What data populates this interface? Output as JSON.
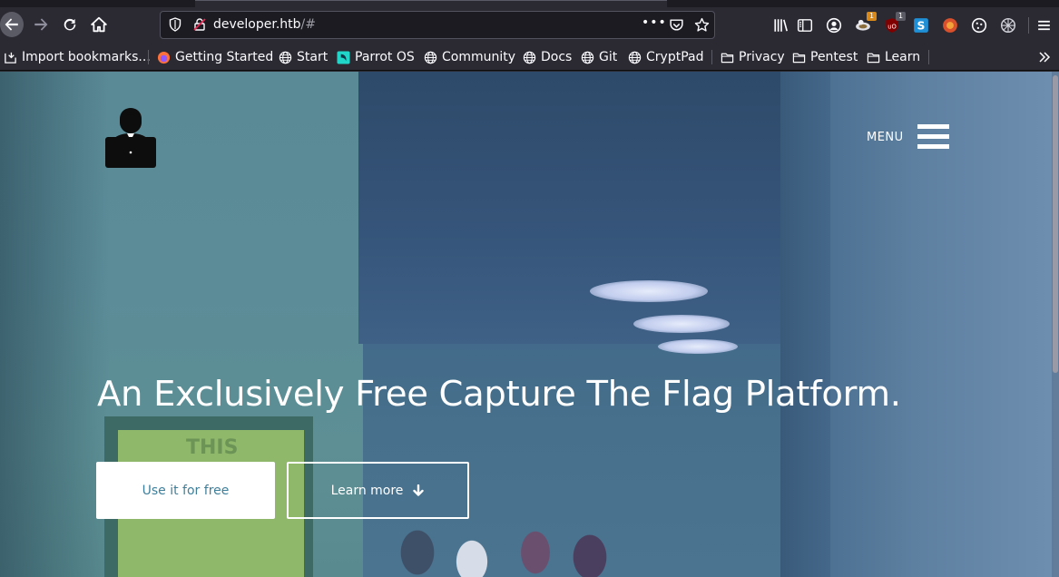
{
  "browser": {
    "url_host": "developer.htb",
    "url_rest": "/#",
    "url_more_glyph": "•••",
    "toolbar_icons": [
      "library-icon",
      "sidebar-icon",
      "account-icon",
      "extension-foxyproxy-icon",
      "extension-ublock-icon",
      "extension-s-icon",
      "extension-wappalyzer-icon",
      "extension-cookie-icon",
      "extension-gear-icon",
      "menu-icon"
    ],
    "badges": {
      "ext1": "1",
      "ext2": "1"
    },
    "colors": {
      "chrome": "#2b2a33",
      "urlbar": "#1c1b22",
      "text": "#fbfbfe"
    }
  },
  "bookmarks": [
    {
      "label": "Import bookmarks...",
      "icon": "import-icon"
    },
    {
      "label": "Getting Started",
      "icon": "firefox-icon"
    },
    {
      "label": "Start",
      "icon": "globe-icon"
    },
    {
      "label": "Parrot OS",
      "icon": "parrot-icon"
    },
    {
      "label": "Community",
      "icon": "globe-icon"
    },
    {
      "label": "Docs",
      "icon": "globe-icon"
    },
    {
      "label": "Git",
      "icon": "globe-icon"
    },
    {
      "label": "CryptPad",
      "icon": "globe-icon"
    },
    {
      "label": "Privacy",
      "icon": "folder-icon"
    },
    {
      "label": "Pentest",
      "icon": "folder-icon"
    },
    {
      "label": "Learn",
      "icon": "folder-icon"
    }
  ],
  "site": {
    "menu_label": "MENU",
    "hero_title": "An Exclusively Free Capture The Flag Platform.",
    "primary_button": "Use it for free",
    "secondary_button": "Learn more",
    "background_poster_text": "THIS",
    "colors": {
      "primary_button_text": "#3f7f9a",
      "hero_text": "#ffffff"
    }
  }
}
